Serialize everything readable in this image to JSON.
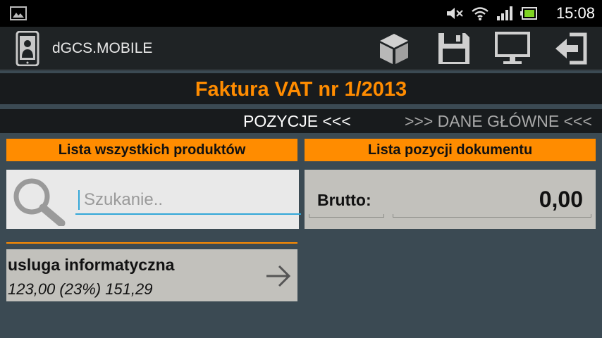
{
  "status_bar": {
    "time": "15:08",
    "icons": [
      "gallery-icon",
      "mute-icon",
      "wifi-icon",
      "signal-icon",
      "battery-icon"
    ]
  },
  "action_bar": {
    "app_title": "dGCS.MOBILE",
    "actions": [
      "package-icon",
      "save-icon",
      "monitor-icon",
      "logout-icon"
    ]
  },
  "document": {
    "title": "Faktura VAT nr 1/2013"
  },
  "tabs": {
    "active": "POZYCJE <<<",
    "inactive": ">>> DANE GŁÓWNE <<<"
  },
  "left_panel": {
    "header": "Lista wszystkich produktów",
    "search_placeholder": "Szukanie..",
    "items": [
      {
        "name": "usluga informatyczna",
        "price": "123,00 (23%) 151,29"
      }
    ]
  },
  "right_panel": {
    "header": "Lista pozycji dokumentu",
    "brutto_label": "Brutto:",
    "brutto_value": "0,00"
  },
  "colors": {
    "accent": "#ff8c00",
    "background": "#3b4a53",
    "panel": "#c2c1bc",
    "search_bg": "#e9e9e9",
    "input_line": "#33a7d8"
  }
}
